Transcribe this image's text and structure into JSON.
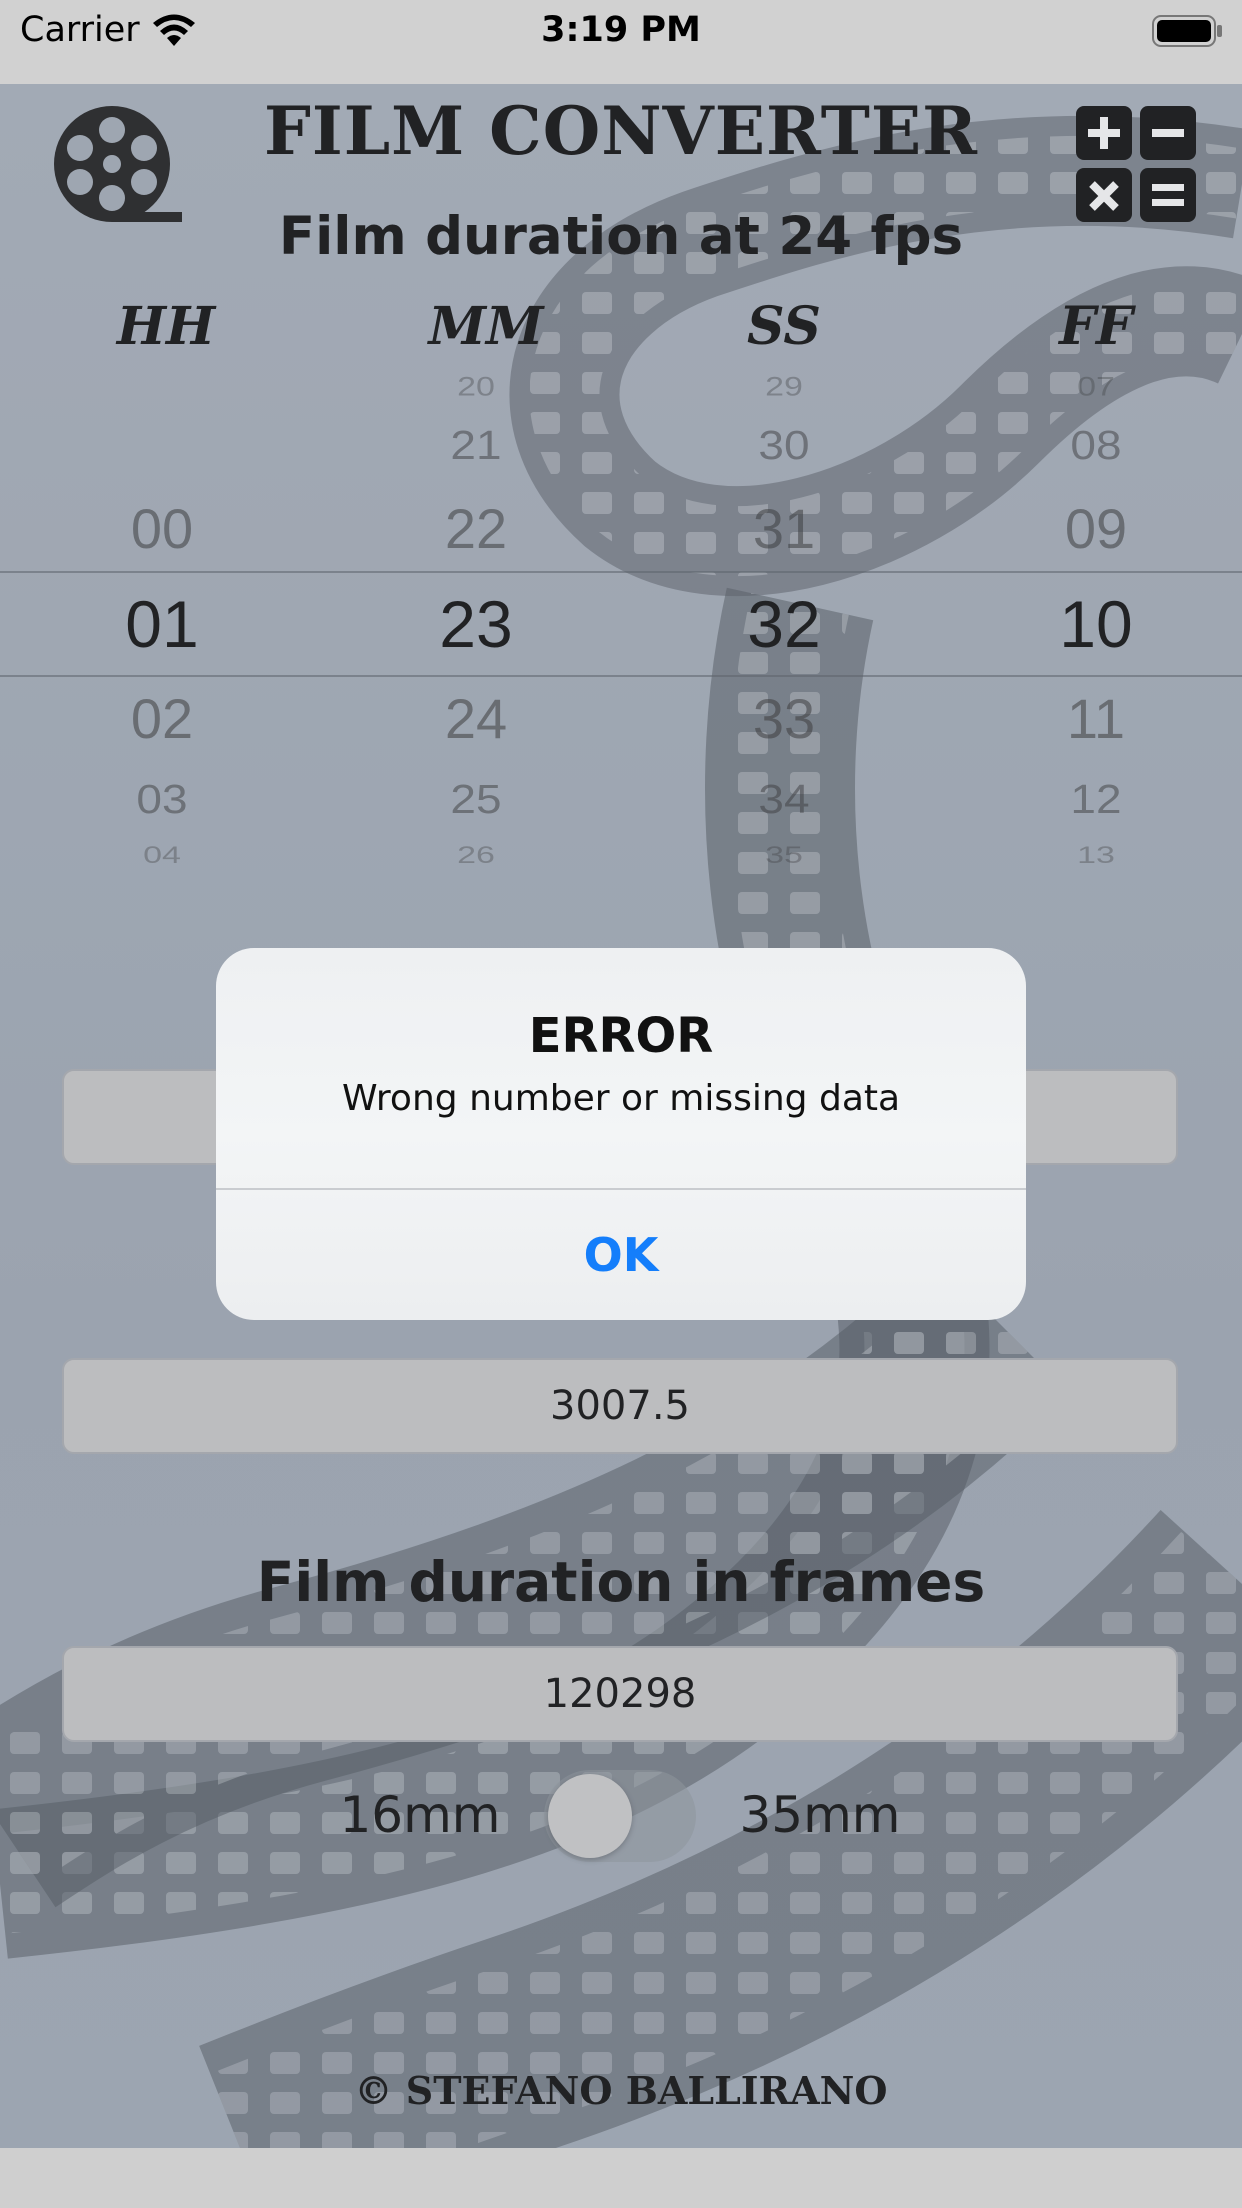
{
  "status_bar": {
    "carrier": "Carrier",
    "time": "3:19 PM",
    "wifi_icon": "wifi-icon",
    "battery_icon": "battery-icon"
  },
  "header": {
    "title": "FILM CONVERTER",
    "reel_icon": "film-reel-icon",
    "calculator_icon": "calculator-icon"
  },
  "duration": {
    "label": "Film duration at 24 fps",
    "columns": [
      {
        "header": "HH",
        "above": [
          "",
          "",
          "00"
        ],
        "selected": "01",
        "below": [
          "02",
          "03",
          "04"
        ]
      },
      {
        "header": "MM",
        "above": [
          "20",
          "21",
          "22"
        ],
        "selected": "23",
        "below": [
          "24",
          "25",
          "26"
        ]
      },
      {
        "header": "SS",
        "above": [
          "29",
          "30",
          "31"
        ],
        "selected": "32",
        "below": [
          "33",
          "34",
          "35"
        ]
      },
      {
        "header": "FF",
        "above": [
          "07",
          "08",
          "09"
        ],
        "selected": "10",
        "below": [
          "11",
          "12",
          "13"
        ]
      }
    ]
  },
  "fields": {
    "obscured_value": "",
    "footage_value": "3007.5",
    "frames_label": "Film duration in frames",
    "frames_value": "120298"
  },
  "gauge_toggle": {
    "left_label": "16mm",
    "right_label": "35mm",
    "is_on": false
  },
  "footer": {
    "copyright": "© STEFANO BALLIRANO"
  },
  "alert": {
    "title": "ERROR",
    "message": "Wrong number or missing data",
    "ok_label": "OK"
  },
  "colors": {
    "accent": "#147efb",
    "background": "#a5aeba",
    "field": "#cdcdcd"
  }
}
